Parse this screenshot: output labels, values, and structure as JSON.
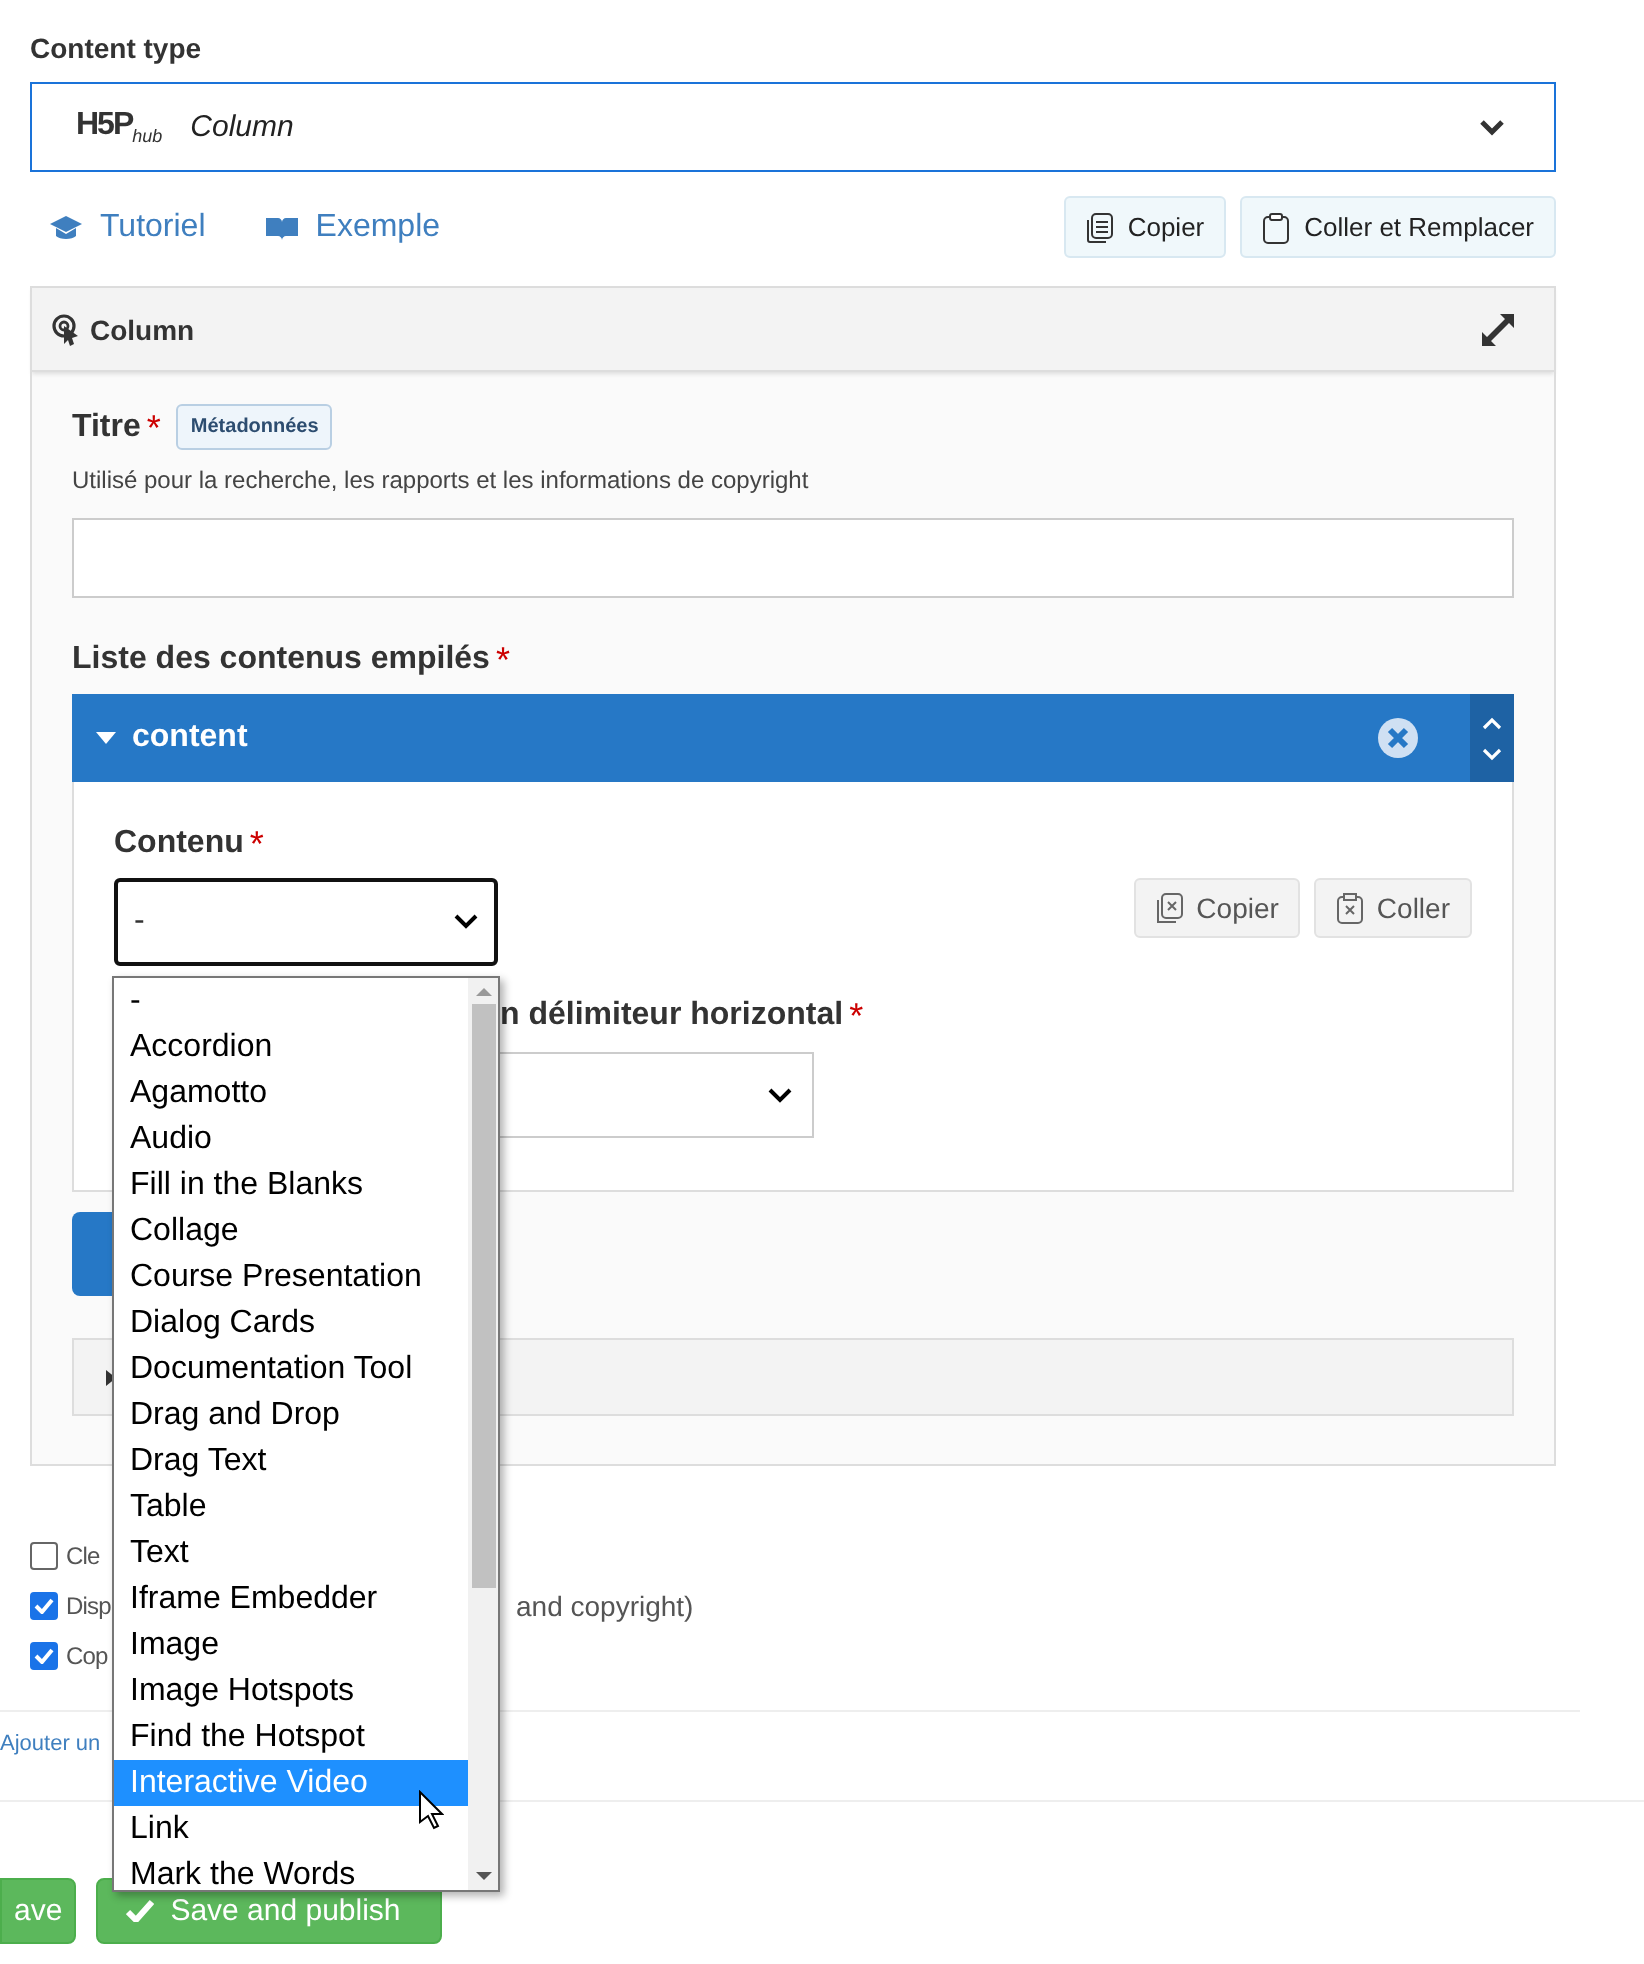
{
  "content_type": {
    "label": "Content type",
    "logo": "H5P",
    "logo_suffix": "hub",
    "value": "Column"
  },
  "links": [
    {
      "label": "Tutoriel",
      "kind": "tutorial"
    },
    {
      "label": "Exemple",
      "kind": "example"
    }
  ],
  "clipboard_buttons": [
    {
      "label": "Copier",
      "kind": "copy"
    },
    {
      "label": "Coller et Remplacer",
      "kind": "paste"
    }
  ],
  "panel": {
    "title": "Column",
    "title_field": {
      "label": "Titre",
      "required_mark": "*",
      "badge": "Métadonnées",
      "description": "Utilisé pour la recherche, les rapports et les informations de copyright"
    },
    "list_label": "Liste des contenus empilés",
    "list_required_mark": "*",
    "item": {
      "title": "content",
      "expanded": true,
      "content_label": "Contenu",
      "content_required_mark": "*",
      "content_value": "-",
      "buttons": [
        {
          "label": "Copier",
          "kind": "copy"
        },
        {
          "label": "Coller",
          "kind": "paste"
        }
      ],
      "delimiter_label": "n délimiteur horizontal",
      "delimiter_required_mark": "*"
    }
  },
  "checkboxes": [
    {
      "label": "Cle",
      "checked": false
    },
    {
      "label": "Disp",
      "tail": "and copyright)",
      "checked": true
    },
    {
      "label": "Cop",
      "checked": true
    }
  ],
  "footer_link": "Ajouter un",
  "save_buttons": [
    {
      "label": "ave",
      "kind": "save"
    },
    {
      "label": "Save and publish",
      "kind": "publish"
    }
  ],
  "dropdown": {
    "options": [
      {
        "label": "-",
        "selected": false
      },
      {
        "label": "Accordion",
        "selected": false
      },
      {
        "label": "Agamotto",
        "selected": false
      },
      {
        "label": "Audio",
        "selected": false
      },
      {
        "label": "Fill in the Blanks",
        "selected": false
      },
      {
        "label": "Collage",
        "selected": false
      },
      {
        "label": "Course Presentation",
        "selected": false
      },
      {
        "label": "Dialog Cards",
        "selected": false
      },
      {
        "label": "Documentation Tool",
        "selected": false
      },
      {
        "label": "Drag and Drop",
        "selected": false
      },
      {
        "label": "Drag Text",
        "selected": false
      },
      {
        "label": "Table",
        "selected": false
      },
      {
        "label": "Text",
        "selected": false
      },
      {
        "label": "Iframe Embedder",
        "selected": false
      },
      {
        "label": "Image",
        "selected": false
      },
      {
        "label": "Image Hotspots",
        "selected": false
      },
      {
        "label": "Find the Hotspot",
        "selected": false
      },
      {
        "label": "Interactive Video",
        "selected": true
      },
      {
        "label": "Link",
        "selected": false
      },
      {
        "label": "Mark the Words",
        "selected": false
      }
    ]
  }
}
